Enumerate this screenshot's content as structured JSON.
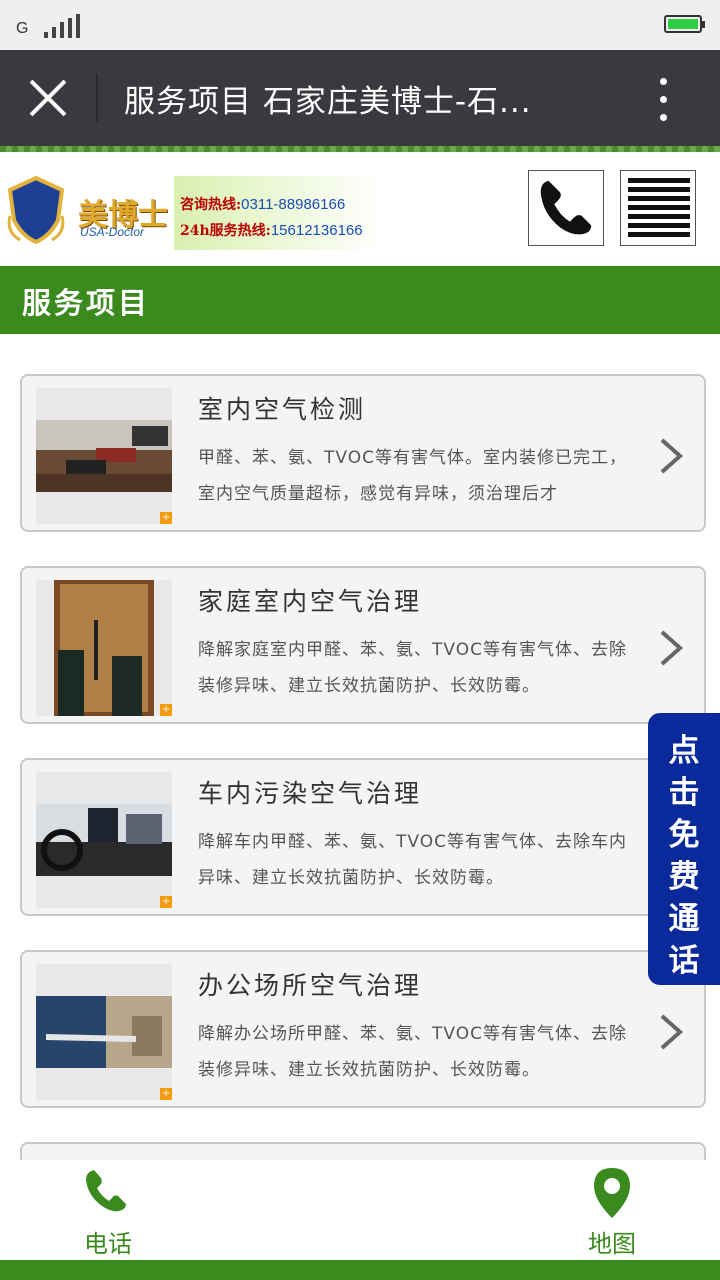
{
  "status_bar": {
    "network": "G"
  },
  "titlebar": {
    "title": "服务项目 石家庄美博士-石..."
  },
  "header": {
    "brand_name": "美博士",
    "brand_sub": "USA-Doctor",
    "hotline_consult_label": "咨询热线:",
    "hotline_consult_number": "0311-88986166",
    "hotline_service_label": "24h服务热线:",
    "hotline_service_number": "15612136166"
  },
  "section": {
    "title": "服务项目"
  },
  "services": [
    {
      "title": "室内空气检测",
      "desc": "甲醛、苯、氨、TVOC等有害气体。室内装修已完工，室内空气质量超标，感觉有异味，须治理后才"
    },
    {
      "title": "家庭室内空气治理",
      "desc": "降解家庭室内甲醛、苯、氨、TVOC等有害气体、去除装修异味、建立长效抗菌防护、长效防霉。"
    },
    {
      "title": "车内污染空气治理",
      "desc": "降解车内甲醛、苯、氨、TVOC等有害气体、去除车内异味、建立长效抗菌防护、长效防霉。"
    },
    {
      "title": "办公场所空气治理",
      "desc": "降解办公场所甲醛、苯、氨、TVOC等有害气体、去除装修异味、建立长效抗菌防护、长效防霉。"
    }
  ],
  "float_call": {
    "chars": [
      "点",
      "击",
      "免",
      "费",
      "通",
      "话"
    ]
  },
  "bottom_nav": {
    "phone_label": "电话",
    "map_label": "地图"
  },
  "colors": {
    "brand_green": "#3a8a1e",
    "float_blue": "#0a2a9c",
    "titlebar": "#393a3f"
  }
}
